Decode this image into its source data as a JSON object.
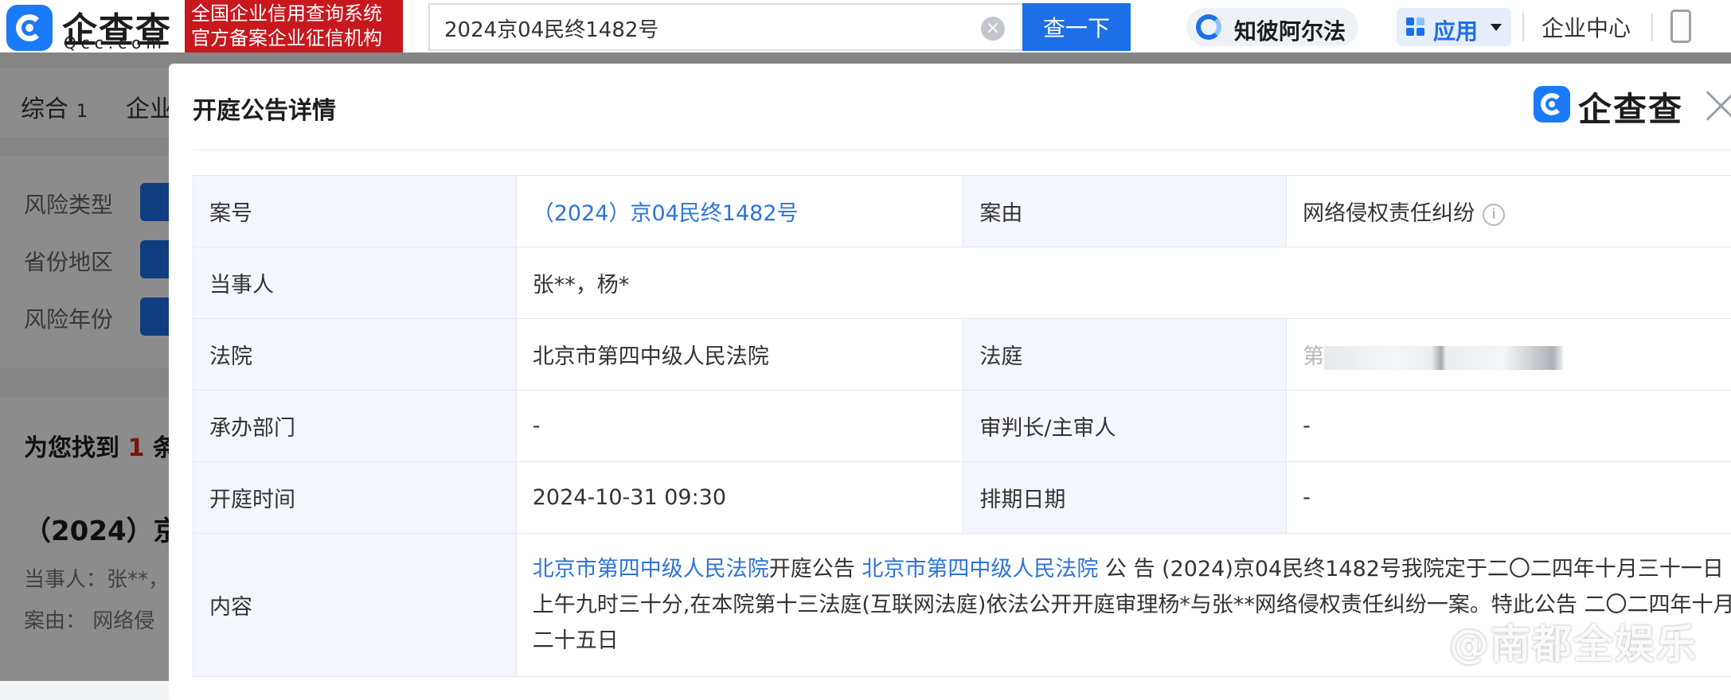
{
  "header": {
    "logo_text": "企查查",
    "logo_domain": "Qcc.com",
    "slogan_line1": "全国企业信用查询系统",
    "slogan_line2": "官方备案企业征信机构",
    "search_value": "2024京04民终1482号",
    "search_button": "查一下",
    "zhibi_label": "知彼阿尔法",
    "apps_label": "应用",
    "enterprise_center": "企业中心"
  },
  "background_page": {
    "tabs": [
      {
        "label": "综合",
        "count": "1"
      },
      {
        "label": "企业"
      }
    ],
    "filters": [
      "风险类型",
      "省份地区",
      "风险年份"
    ],
    "found_prefix": "为您找到",
    "found_count": "1",
    "found_suffix": "条",
    "result": {
      "title": "（2024）京",
      "party": "当事人：张**，",
      "cause": "案由：  网络侵"
    }
  },
  "modal": {
    "title": "开庭公告详情",
    "brand": "企查查",
    "rows": {
      "case_no_label": "案号",
      "case_no_value": "（2024）京04民终1482号",
      "cause_label": "案由",
      "cause_value": "网络侵权责任纠纷",
      "party_label": "当事人",
      "party_value": "张**，杨*",
      "court_label": "法院",
      "court_value": "北京市第四中级人民法院",
      "room_label": "法庭",
      "room_value_first_char": "第",
      "dept_label": "承办部门",
      "dept_value": "-",
      "judge_label": "审判长/主审人",
      "judge_value": "-",
      "time_label": "开庭时间",
      "time_value": "2024-10-31 09:30",
      "schedule_label": "排期日期",
      "schedule_value": "-",
      "content_label": "内容",
      "content_link1": "北京市第四中级人民法院",
      "content_text1": "开庭公告 ",
      "content_link2": "北京市第四中级人民法院",
      "content_text2": " 公 告 (2024)京04民终1482号我院定于二〇二四年十月三十一日 上午九时三十分,在本院第十三法庭(互联网法庭)依法公开开庭审理杨*与张**网络侵权责任纠纷一案。特此公告 二〇二四年十月二十五日"
    }
  },
  "watermark": "@南都全娱乐",
  "colors": {
    "brand_blue": "#1a7af8",
    "link_blue": "#2d74d6",
    "slogan_red": "#c8181e",
    "label_bg": "#f3f7fd"
  }
}
